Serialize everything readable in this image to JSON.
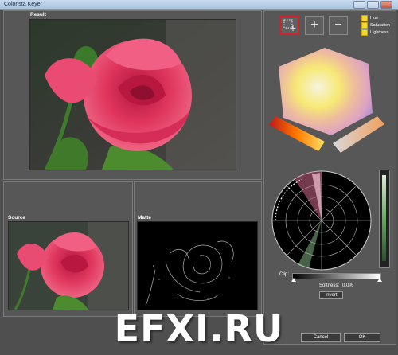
{
  "window": {
    "title": "Colorista Keyer"
  },
  "panels": {
    "result_label": "Result",
    "source_label": "Source",
    "matte_label": "Matte"
  },
  "tools": {
    "add_selection_icon": "marquee-plus-icon",
    "plus_label": "+",
    "minus_label": "−"
  },
  "options": [
    {
      "label": "Hue",
      "checked": true
    },
    {
      "label": "Saturation",
      "checked": true
    },
    {
      "label": "Lightness",
      "checked": true
    }
  ],
  "controls": {
    "clip_label": "Clip:",
    "softness_label": "Softness:",
    "softness_value": "0.0%",
    "invert_label": "Invert"
  },
  "footer": {
    "cancel_label": "Cancel",
    "ok_label": "OK"
  },
  "watermark": "EFXI.RU",
  "colors": {
    "accent_red": "#d3222a",
    "checkbox_yellow": "#f2d631",
    "panel_bg": "#575757"
  }
}
